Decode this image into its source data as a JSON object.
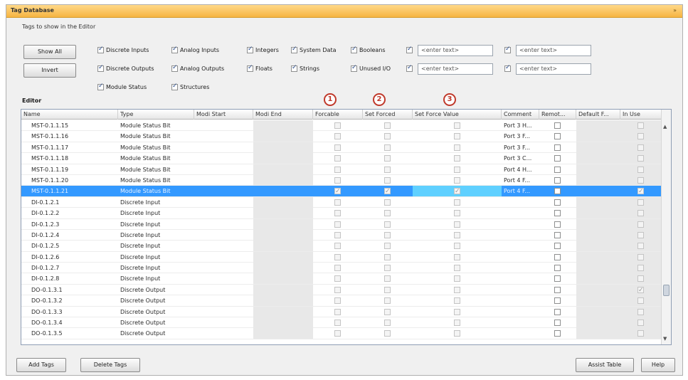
{
  "window": {
    "title": "Tag Database",
    "collapse_glyph": "»"
  },
  "filter": {
    "group_label": "Tags to show in the Editor",
    "show_all_label": "Show All",
    "invert_label": "Invert",
    "checkboxes": [
      {
        "label": "Discrete Inputs",
        "checked": true
      },
      {
        "label": "Discrete Outputs",
        "checked": true
      },
      {
        "label": "Module Status",
        "checked": true
      },
      {
        "label": "Analog Inputs",
        "checked": true
      },
      {
        "label": "Analog Outputs",
        "checked": true
      },
      {
        "label": "Structures",
        "checked": true
      },
      {
        "label": "Integers",
        "checked": true
      },
      {
        "label": "Floats",
        "checked": true
      },
      {
        "label": "System Data",
        "checked": true
      },
      {
        "label": "Strings",
        "checked": true
      },
      {
        "label": "Booleans",
        "checked": true
      },
      {
        "label": "Unused I/O",
        "checked": true
      }
    ],
    "text_filters": [
      {
        "placeholder": "<enter text>",
        "checked": true
      },
      {
        "placeholder": "<enter text>",
        "checked": true
      },
      {
        "placeholder": "<enter text>",
        "checked": true
      },
      {
        "placeholder": "<enter text>",
        "checked": true
      }
    ]
  },
  "editor": {
    "label": "Editor",
    "columns": [
      "Name",
      "Type",
      "Modi Start",
      "Modi End",
      "Forcable",
      "Set Forced",
      "Set Force Value",
      "Comment",
      "Remot...",
      "Default F...",
      "In Use"
    ],
    "callouts": [
      "1",
      "2",
      "3"
    ],
    "rows": [
      {
        "name": "MST-0.1.1.15",
        "type": "Module Status Bit",
        "forcable": false,
        "set_forced": false,
        "force_value": false,
        "comment": "Port 3 H...",
        "remote": false,
        "in_use": false,
        "selected": false
      },
      {
        "name": "MST-0.1.1.16",
        "type": "Module Status Bit",
        "forcable": false,
        "set_forced": false,
        "force_value": false,
        "comment": "Port 3 F...",
        "remote": false,
        "in_use": false,
        "selected": false
      },
      {
        "name": "MST-0.1.1.17",
        "type": "Module Status Bit",
        "forcable": false,
        "set_forced": false,
        "force_value": false,
        "comment": "Port 3 F...",
        "remote": false,
        "in_use": false,
        "selected": false
      },
      {
        "name": "MST-0.1.1.18",
        "type": "Module Status Bit",
        "forcable": false,
        "set_forced": false,
        "force_value": false,
        "comment": "Port 3 C...",
        "remote": false,
        "in_use": false,
        "selected": false
      },
      {
        "name": "MST-0.1.1.19",
        "type": "Module Status Bit",
        "forcable": false,
        "set_forced": false,
        "force_value": false,
        "comment": "Port 4 H...",
        "remote": false,
        "in_use": false,
        "selected": false
      },
      {
        "name": "MST-0.1.1.20",
        "type": "Module Status Bit",
        "forcable": false,
        "set_forced": false,
        "force_value": false,
        "comment": "Port 4 F...",
        "remote": false,
        "in_use": false,
        "selected": false
      },
      {
        "name": "MST-0.1.1.21",
        "type": "Module Status Bit",
        "forcable": true,
        "set_forced": true,
        "force_value": true,
        "comment": "Port 4 F...",
        "remote": false,
        "in_use": true,
        "selected": true
      },
      {
        "name": "DI-0.1.2.1",
        "type": "Discrete Input",
        "forcable": false,
        "set_forced": false,
        "force_value": false,
        "comment": "",
        "remote": false,
        "in_use": false,
        "selected": false
      },
      {
        "name": "DI-0.1.2.2",
        "type": "Discrete Input",
        "forcable": false,
        "set_forced": false,
        "force_value": false,
        "comment": "",
        "remote": false,
        "in_use": false,
        "selected": false
      },
      {
        "name": "DI-0.1.2.3",
        "type": "Discrete Input",
        "forcable": false,
        "set_forced": false,
        "force_value": false,
        "comment": "",
        "remote": false,
        "in_use": false,
        "selected": false
      },
      {
        "name": "DI-0.1.2.4",
        "type": "Discrete Input",
        "forcable": false,
        "set_forced": false,
        "force_value": false,
        "comment": "",
        "remote": false,
        "in_use": false,
        "selected": false
      },
      {
        "name": "DI-0.1.2.5",
        "type": "Discrete Input",
        "forcable": false,
        "set_forced": false,
        "force_value": false,
        "comment": "",
        "remote": false,
        "in_use": false,
        "selected": false
      },
      {
        "name": "DI-0.1.2.6",
        "type": "Discrete Input",
        "forcable": false,
        "set_forced": false,
        "force_value": false,
        "comment": "",
        "remote": false,
        "in_use": false,
        "selected": false
      },
      {
        "name": "DI-0.1.2.7",
        "type": "Discrete Input",
        "forcable": false,
        "set_forced": false,
        "force_value": false,
        "comment": "",
        "remote": false,
        "in_use": false,
        "selected": false
      },
      {
        "name": "DI-0.1.2.8",
        "type": "Discrete Input",
        "forcable": false,
        "set_forced": false,
        "force_value": false,
        "comment": "",
        "remote": false,
        "in_use": false,
        "selected": false
      },
      {
        "name": "DO-0.1.3.1",
        "type": "Discrete Output",
        "forcable": false,
        "set_forced": false,
        "force_value": false,
        "comment": "",
        "remote": false,
        "in_use": true,
        "selected": false
      },
      {
        "name": "DO-0.1.3.2",
        "type": "Discrete Output",
        "forcable": false,
        "set_forced": false,
        "force_value": false,
        "comment": "",
        "remote": false,
        "in_use": false,
        "selected": false
      },
      {
        "name": "DO-0.1.3.3",
        "type": "Discrete Output",
        "forcable": false,
        "set_forced": false,
        "force_value": false,
        "comment": "",
        "remote": false,
        "in_use": false,
        "selected": false
      },
      {
        "name": "DO-0.1.3.4",
        "type": "Discrete Output",
        "forcable": false,
        "set_forced": false,
        "force_value": false,
        "comment": "",
        "remote": false,
        "in_use": false,
        "selected": false
      },
      {
        "name": "DO-0.1.3.5",
        "type": "Discrete Output",
        "forcable": false,
        "set_forced": false,
        "force_value": false,
        "comment": "",
        "remote": false,
        "in_use": false,
        "selected": false
      }
    ]
  },
  "footer": {
    "add_tags_label": "Add Tags",
    "delete_tags_label": "Delete Tags",
    "assist_table_label": "Assist Table",
    "help_label": "Help"
  },
  "colors": {
    "title_bar": "#f6b542",
    "selection": "#3399ff",
    "force_value_highlight": "#5fd0ff",
    "callout": "#c0392b"
  }
}
